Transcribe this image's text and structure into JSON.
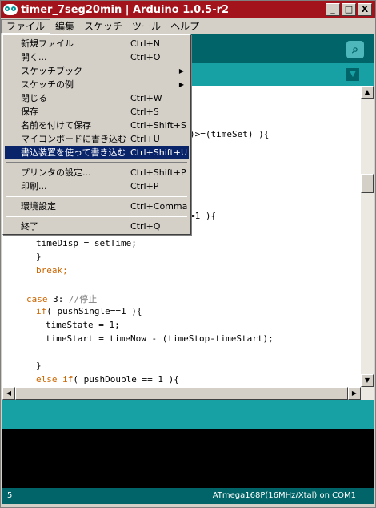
{
  "window": {
    "title": "timer_7seg20min | Arduino 1.0.5-r2",
    "minimize": "_",
    "maximize": "□",
    "close": "X"
  },
  "menubar": {
    "file": "ファイル",
    "edit": "編集",
    "sketch": "スケッチ",
    "tools": "ツール",
    "help": "ヘルプ"
  },
  "file_menu": {
    "new": {
      "label": "新規ファイル",
      "shortcut": "Ctrl+N"
    },
    "open": {
      "label": "開く...",
      "shortcut": "Ctrl+O"
    },
    "sketchbook": {
      "label": "スケッチブック"
    },
    "examples": {
      "label": "スケッチの例"
    },
    "close": {
      "label": "閉じる",
      "shortcut": "Ctrl+W"
    },
    "save": {
      "label": "保存",
      "shortcut": "Ctrl+S"
    },
    "save_as": {
      "label": "名前を付けて保存",
      "shortcut": "Ctrl+Shift+S"
    },
    "upload": {
      "label": "マイコンボードに書き込む",
      "shortcut": "Ctrl+U"
    },
    "upload_programmer": {
      "label": "書込装置を使って書き込む",
      "shortcut": "Ctrl+Shift+U"
    },
    "page_setup": {
      "label": "プリンタの設定...",
      "shortcut": "Ctrl+Shift+P"
    },
    "print": {
      "label": "印刷...",
      "shortcut": "Ctrl+P"
    },
    "preferences": {
      "label": "環境設定",
      "shortcut": "Ctrl+Comma"
    },
    "quit": {
      "label": "終了",
      "shortcut": "Ctrl+Q"
    }
  },
  "code": {
    "l1": ")>=(timeSet) ){",
    "l2": "=1 ){",
    "l3": "timeDisp = setTime;",
    "l4": "}",
    "l5": "break;",
    "l6_kw": "case",
    "l6_rest": " 3: ",
    "l6_cm": "//停止",
    "l7_kw": "if",
    "l7_rest": "( pushSingle==1 ){",
    "l8": "timeState = 1;",
    "l9": "timeStart = timeNow - (timeStop-timeStart);",
    "l10": "}",
    "l11_kw": "else if",
    "l11_rest": "( pushDouble == 1 ){"
  },
  "footer": {
    "line_number": "5",
    "board": "ATmega168P(16MHz/Xtal) on COM1"
  },
  "icons": {
    "serial_monitor": "serial-monitor-icon",
    "tab_menu": "tab-menu-icon"
  },
  "colors": {
    "titlebar": "#a2131b",
    "toolbar": "#006468",
    "tabs": "#17a1a5",
    "keyword": "#cc6600",
    "comment": "#7e7e7e",
    "highlight": "#0a246a"
  }
}
